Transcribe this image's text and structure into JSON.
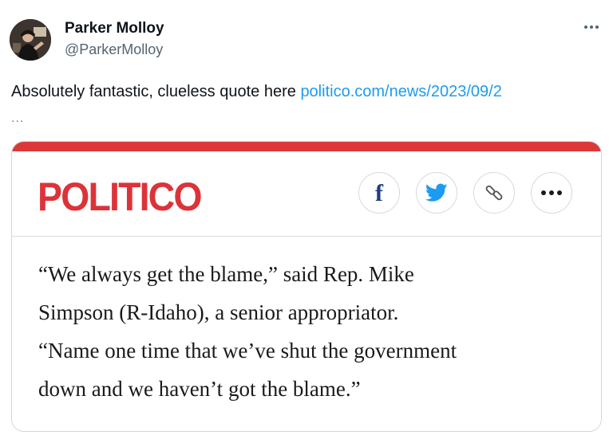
{
  "tweet": {
    "author": {
      "name": "Parker Molloy",
      "handle": "@ParkerMolloy"
    },
    "more_label": "More",
    "text": "Absolutely fantastic, clueless quote here ",
    "link_text": "politico.com/news/2023/09/2",
    "link_ellipsis": "...",
    "colors": {
      "link": "#1d9bf0",
      "text": "#0f1419",
      "secondary": "#536471"
    }
  },
  "card": {
    "brand": "POLITICO",
    "colors": {
      "accent_bar": "#dc3839",
      "logo": "#dc3339"
    },
    "share_buttons": [
      {
        "name": "facebook",
        "icon": "facebook-icon"
      },
      {
        "name": "twitter",
        "icon": "twitter-bird-icon"
      },
      {
        "name": "copy-link",
        "icon": "link-icon"
      },
      {
        "name": "more",
        "icon": "more-horizontal-icon"
      }
    ],
    "quote_lines": [
      "“We always get the blame,” said Rep. Mike",
      "Simpson (R-Idaho), a senior appropriator.",
      "“Name one time that we’ve shut the government",
      "down and we haven’t got the blame.”"
    ]
  }
}
